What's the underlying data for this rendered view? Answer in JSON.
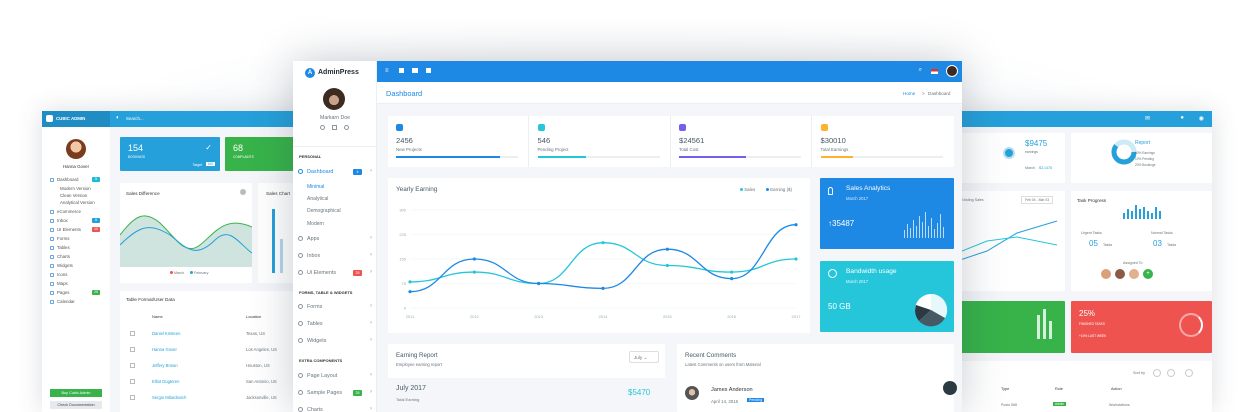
{
  "left": {
    "brand": "CUBIC ADMIN",
    "search": "Search...",
    "user": "Hanna Gover",
    "nav": [
      {
        "label": "Dashboard",
        "badge": "5",
        "badge_color": "#1ebbd9"
      },
      {
        "label": "Modern Version"
      },
      {
        "label": "Clean Version"
      },
      {
        "label": "Analytical Version"
      },
      {
        "label": "eCommerce"
      },
      {
        "label": "Inbox",
        "badge": "5",
        "badge_color": "#26a0da"
      },
      {
        "label": "UI Elements",
        "badge": "10",
        "badge_color": "#ef5350"
      },
      {
        "label": "Forms"
      },
      {
        "label": "Tables"
      },
      {
        "label": "Charts"
      },
      {
        "label": "Widgets"
      },
      {
        "label": "Icons"
      },
      {
        "label": "Maps"
      },
      {
        "label": "Pages",
        "badge": "25",
        "badge_color": "#37b34a"
      },
      {
        "label": "Calendar"
      }
    ],
    "buy": "Buy Cubic Admin",
    "doc": "Check Documentation",
    "stat1": {
      "value": "154",
      "label": "BOOKINGS",
      "target": "Target",
      "target_val": "160"
    },
    "stat2": {
      "value": "68",
      "label": "COMPLAINTS"
    },
    "sales_diff": "Sales Difference",
    "sales_chart": "Sales Chart",
    "legend": [
      "March",
      "February"
    ],
    "table_title": "Table Format/User Data",
    "cols": [
      "Name",
      "Location"
    ],
    "rows": [
      [
        "Daniel Kristeen",
        "Texas, US"
      ],
      [
        "Hanna Gover",
        "Los Angeles, US"
      ],
      [
        "Jeffery Brown",
        "Houston, US"
      ],
      [
        "Elliot Dugteren",
        "San Antonio, US"
      ],
      [
        "Sergio Milardovich",
        "Jacksonville, US"
      ]
    ]
  },
  "center": {
    "brand": "AdminPress",
    "user": "Markarn Doe",
    "sec_personal": "PERSONAL",
    "nav": [
      {
        "label": "Dashboard",
        "badge": "4"
      },
      {
        "label": "Minimal"
      },
      {
        "label": "Analytical"
      },
      {
        "label": "Demographical"
      },
      {
        "label": "Modern"
      },
      {
        "label": "Apps"
      },
      {
        "label": "Inbox"
      },
      {
        "label": "Ui Elements",
        "badge": "25"
      }
    ],
    "sec_forms": "FORMS, TABLE & WIDGETS",
    "nav2": [
      "Forms",
      "Tables",
      "Widgets"
    ],
    "sec_extra": "EXTRA COMPONENTS",
    "nav3": [
      {
        "label": "Page Layout"
      },
      {
        "label": "Sample Pages",
        "badge": "25"
      },
      {
        "label": "Charts"
      }
    ],
    "page_title": "Dashboard",
    "crumb_home": "Home",
    "crumb_sep": ">",
    "crumb_cur": "Dashboard",
    "stats": [
      {
        "value": "2456",
        "label": "New Projects",
        "color": "#1e88e5",
        "fill": 0.85
      },
      {
        "value": "546",
        "label": "Pending Project",
        "color": "#26c6da",
        "fill": 0.4
      },
      {
        "value": "$24561",
        "label": "Total Cost",
        "color": "#7460ee",
        "fill": 0.55
      },
      {
        "value": "$30010",
        "label": "Total Earnings",
        "color": "#ffb22b",
        "fill": 0.27
      }
    ],
    "yearly_title": "Yearly Earning",
    "legend": [
      "Sales",
      "Earning ($)"
    ],
    "analytics_title": "Sales Analytics",
    "analytics_date": "March 2017",
    "analytics_value": "35487",
    "bandwidth_title": "Bandwidth usage",
    "bandwidth_date": "March 2017",
    "bandwidth_value": "50 GB",
    "earning_title": "Earning Report",
    "earning_sub": "Employee earning report",
    "month_select": "July",
    "earning_month": "July 2017",
    "earning_sub2": "Total Earning",
    "earning_amount": "$5470",
    "recent_title": "Recent Comments",
    "recent_sub": "Latest Comments on users from Material",
    "comment_name": "James Anderson",
    "comment_date": "April 14, 2016",
    "comment_status": "Pending"
  },
  "chart_data": {
    "type": "line",
    "categories": [
      "2011",
      "2012",
      "2013",
      "2014",
      "2015",
      "2016",
      "2017"
    ],
    "ylim": [
      0,
      300
    ],
    "yticks": [
      "300",
      "225",
      "150",
      "75",
      "0"
    ],
    "series": [
      {
        "name": "Sales",
        "values": [
          80,
          110,
          75,
          200,
          130,
          110,
          150
        ],
        "color": "#26c6da"
      },
      {
        "name": "Earning ($)",
        "values": [
          50,
          150,
          75,
          60,
          180,
          90,
          255
        ],
        "color": "#1e88e5"
      }
    ]
  },
  "right": {
    "amount": "$9475",
    "amount_label": "earnings",
    "month": "March",
    "month_val": "$3,1478",
    "report": "Report",
    "report_items": [
      "60% Earnings",
      "10% Pending",
      "20% Bookings"
    ],
    "legend": "Existing Sales",
    "range": "Feb 04 - Mar 03",
    "task_title": "Task Progress",
    "urgent": "Urgent Tasks",
    "urgent_val": "05",
    "urgent_unit": "Tasks",
    "normal": "Normal Tasks",
    "normal_val": "03",
    "normal_unit": "Tasks",
    "assigned": "Assigned To",
    "pct": "25%",
    "pct_label": "FINISHED TASKS",
    "pct_sub": "+15% LAST WEEK",
    "sortby": "Sort by",
    "cols": [
      "Type",
      "Role",
      "Action"
    ],
    "row_type": "Posts 568",
    "row_role": "Admin",
    "row_action": "Workstations"
  }
}
